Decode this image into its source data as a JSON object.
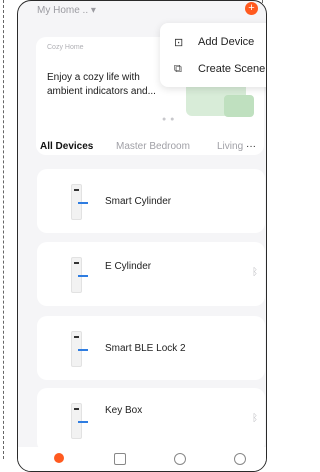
{
  "header": {
    "home_name": "My Home .. ▾",
    "add_icon": "plus-icon",
    "accent": "#ff5a1f"
  },
  "menu": {
    "items": [
      {
        "label": "Add Device",
        "icon": "add-device-icon"
      },
      {
        "label": "Create Scene",
        "icon": "create-scene-icon"
      }
    ]
  },
  "banner": {
    "tag": "Cozy Home",
    "text": "Enjoy a cozy life with ambient indicators and...",
    "dots": "● ●"
  },
  "tabs": {
    "items": [
      "All Devices",
      "Master Bedroom",
      "Living"
    ],
    "more": "···",
    "active": "All Devices"
  },
  "devices": [
    {
      "name": "Smart Cylinder",
      "bluetooth": false
    },
    {
      "name": "E Cylinder",
      "bluetooth": true
    },
    {
      "name": "Smart BLE Lock 2",
      "bluetooth": false
    },
    {
      "name": "Key Box",
      "bluetooth": true
    }
  ],
  "tabbar": {
    "icons": [
      "home-icon",
      "scene-icon",
      "smart-icon",
      "me-icon"
    ]
  }
}
